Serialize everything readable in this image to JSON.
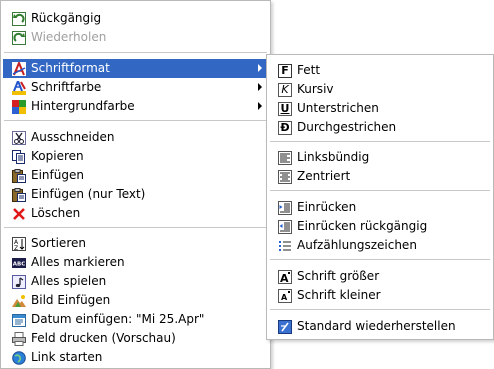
{
  "main_menu": {
    "undo": "Rückgängig",
    "redo": "Wiederholen",
    "font_format": "Schriftformat",
    "font_color": "Schriftfarbe",
    "background_color": "Hintergrundfarbe",
    "cut": "Ausschneiden",
    "copy": "Kopieren",
    "paste": "Einfügen",
    "paste_text": "Einfügen (nur Text)",
    "delete": "Löschen",
    "sort": "Sortieren",
    "select_all": "Alles markieren",
    "play_all": "Alles spielen",
    "insert_image": "Bild Einfügen",
    "insert_date": "Datum einfügen: \"Mi 25.Apr\"",
    "print_field": "Feld drucken (Vorschau)",
    "start_link": "Link starten"
  },
  "submenu": {
    "bold": "Fett",
    "italic": "Kursiv",
    "underline": "Unterstrichen",
    "strikethrough": "Durchgestrichen",
    "align_left": "Linksbündig",
    "center": "Zentriert",
    "indent": "Einrücken",
    "outdent": "Einrücken rückgängig",
    "bullets": "Aufzählungszeichen",
    "font_larger": "Schrift größer",
    "font_smaller": "Schrift kleiner",
    "restore_default": "Standard wiederherstellen"
  },
  "icon_glyphs": {
    "bold": "F",
    "italic": "K",
    "underline": "U",
    "strikethrough": "Đ",
    "select_all": "ABC",
    "sort": "↓",
    "play_all": "♪"
  },
  "colors": {
    "highlight": "#3267c4",
    "disabled_text": "#a0a0a0",
    "border": "#b9b9b9"
  }
}
